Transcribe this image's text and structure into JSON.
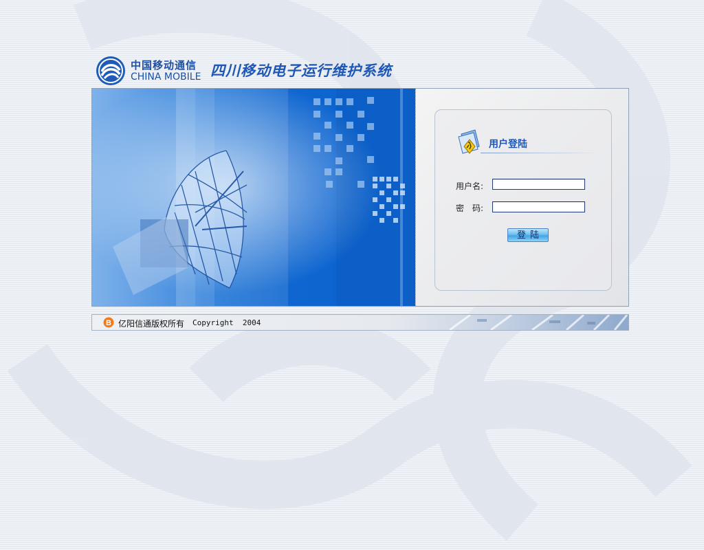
{
  "header": {
    "logo_cn": "中国移动通信",
    "logo_en": "CHINA MOBILE",
    "system_title": "四川移动电子运行维护系统"
  },
  "login": {
    "panel_title": "用户登陆",
    "username_label": "用户名:",
    "username_value": "",
    "password_label": "密　码:",
    "password_value": "",
    "submit_label": "登陆"
  },
  "footer": {
    "company": "亿阳信通版权所有",
    "copyright": "Copyright  2004"
  },
  "colors": {
    "brand_blue": "#1f57b4",
    "hero_blue": "#0a5cc6",
    "page_bg": "#e7ebf2",
    "footer_icon": "#f07a1c"
  },
  "icons": {
    "logo": "china-mobile-logo",
    "panel": "user-folder-icon",
    "footer": "company-logo-icon"
  }
}
